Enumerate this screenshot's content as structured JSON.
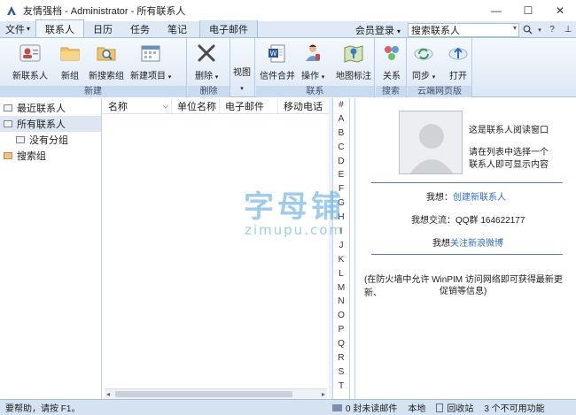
{
  "window": {
    "title": "友情强档 - Administrator - 所有联系人",
    "minimize_glyph": "—",
    "maximize_glyph": "☐",
    "close_glyph": "✕"
  },
  "tabs": {
    "file": "文件",
    "file_arrow": "▾",
    "contacts": "联系人",
    "calendar": "日历",
    "tasks": "任务",
    "notes": "笔记",
    "email": "电子邮件"
  },
  "topright": {
    "login": "会员登录",
    "login_arrow": "▾",
    "search_value": "搜索联系人",
    "search_dropdown": "▾",
    "search_icon_glyph": "🔍",
    "help_glyph": "?",
    "pin_glyph": "⊥"
  },
  "ribbon": {
    "groups": {
      "new": "新建",
      "delete": "删除",
      "contact": "联系",
      "search": "搜索",
      "cloud": "云端网页版"
    },
    "buttons": {
      "new_contact": "新联系人",
      "new_group": "新组",
      "new_search_group": "新搜索组",
      "new_item": "新建项目",
      "delete": "删除",
      "view": "视图",
      "mail_merge": "信件合并",
      "operate": "操作",
      "map_mark": "地图标注",
      "relation": "关系",
      "sync": "同步",
      "open": "打开"
    },
    "dropdown_glyph": "▾"
  },
  "tree": {
    "items": [
      {
        "label": "最近联系人"
      },
      {
        "label": "所有联系人"
      },
      {
        "label": "没有分组"
      },
      {
        "label": "搜索组"
      }
    ]
  },
  "list": {
    "columns": [
      "名称",
      "单位名称",
      "电子邮件",
      "移动电话"
    ],
    "scroll_left": "◂",
    "scroll_right": "▸"
  },
  "alphabet": {
    "hash": "#",
    "letters": [
      "A",
      "B",
      "C",
      "D",
      "E",
      "F",
      "G",
      "H",
      "I",
      "J",
      "K",
      "L",
      "M",
      "N",
      "O",
      "P",
      "Q",
      "R",
      "S",
      "T"
    ]
  },
  "reading": {
    "line1": "这是联系人阅读窗口",
    "line2": "请在列表中选择一个",
    "line3": "联系人即可显示内容",
    "want_label": "我想：",
    "want_link": "创建新联系人",
    "chat_label": "我想交流：",
    "chat_value": "QQ群 164622177",
    "follow_label": "我想",
    "follow_link": "关注新浪微博",
    "notice_1": "(在防火墙中允许 WinPIM 访问网络即可获得最新更新、",
    "notice_2": "促销等信息)"
  },
  "status": {
    "help": "要帮助，请按 F1。",
    "unread": "0 封未读邮件",
    "local": "本地",
    "recycle": "回收站",
    "unavailable": "3 个不可用功能"
  },
  "watermark": {
    "cn": "字母铺",
    "en": "zimupu.com"
  }
}
